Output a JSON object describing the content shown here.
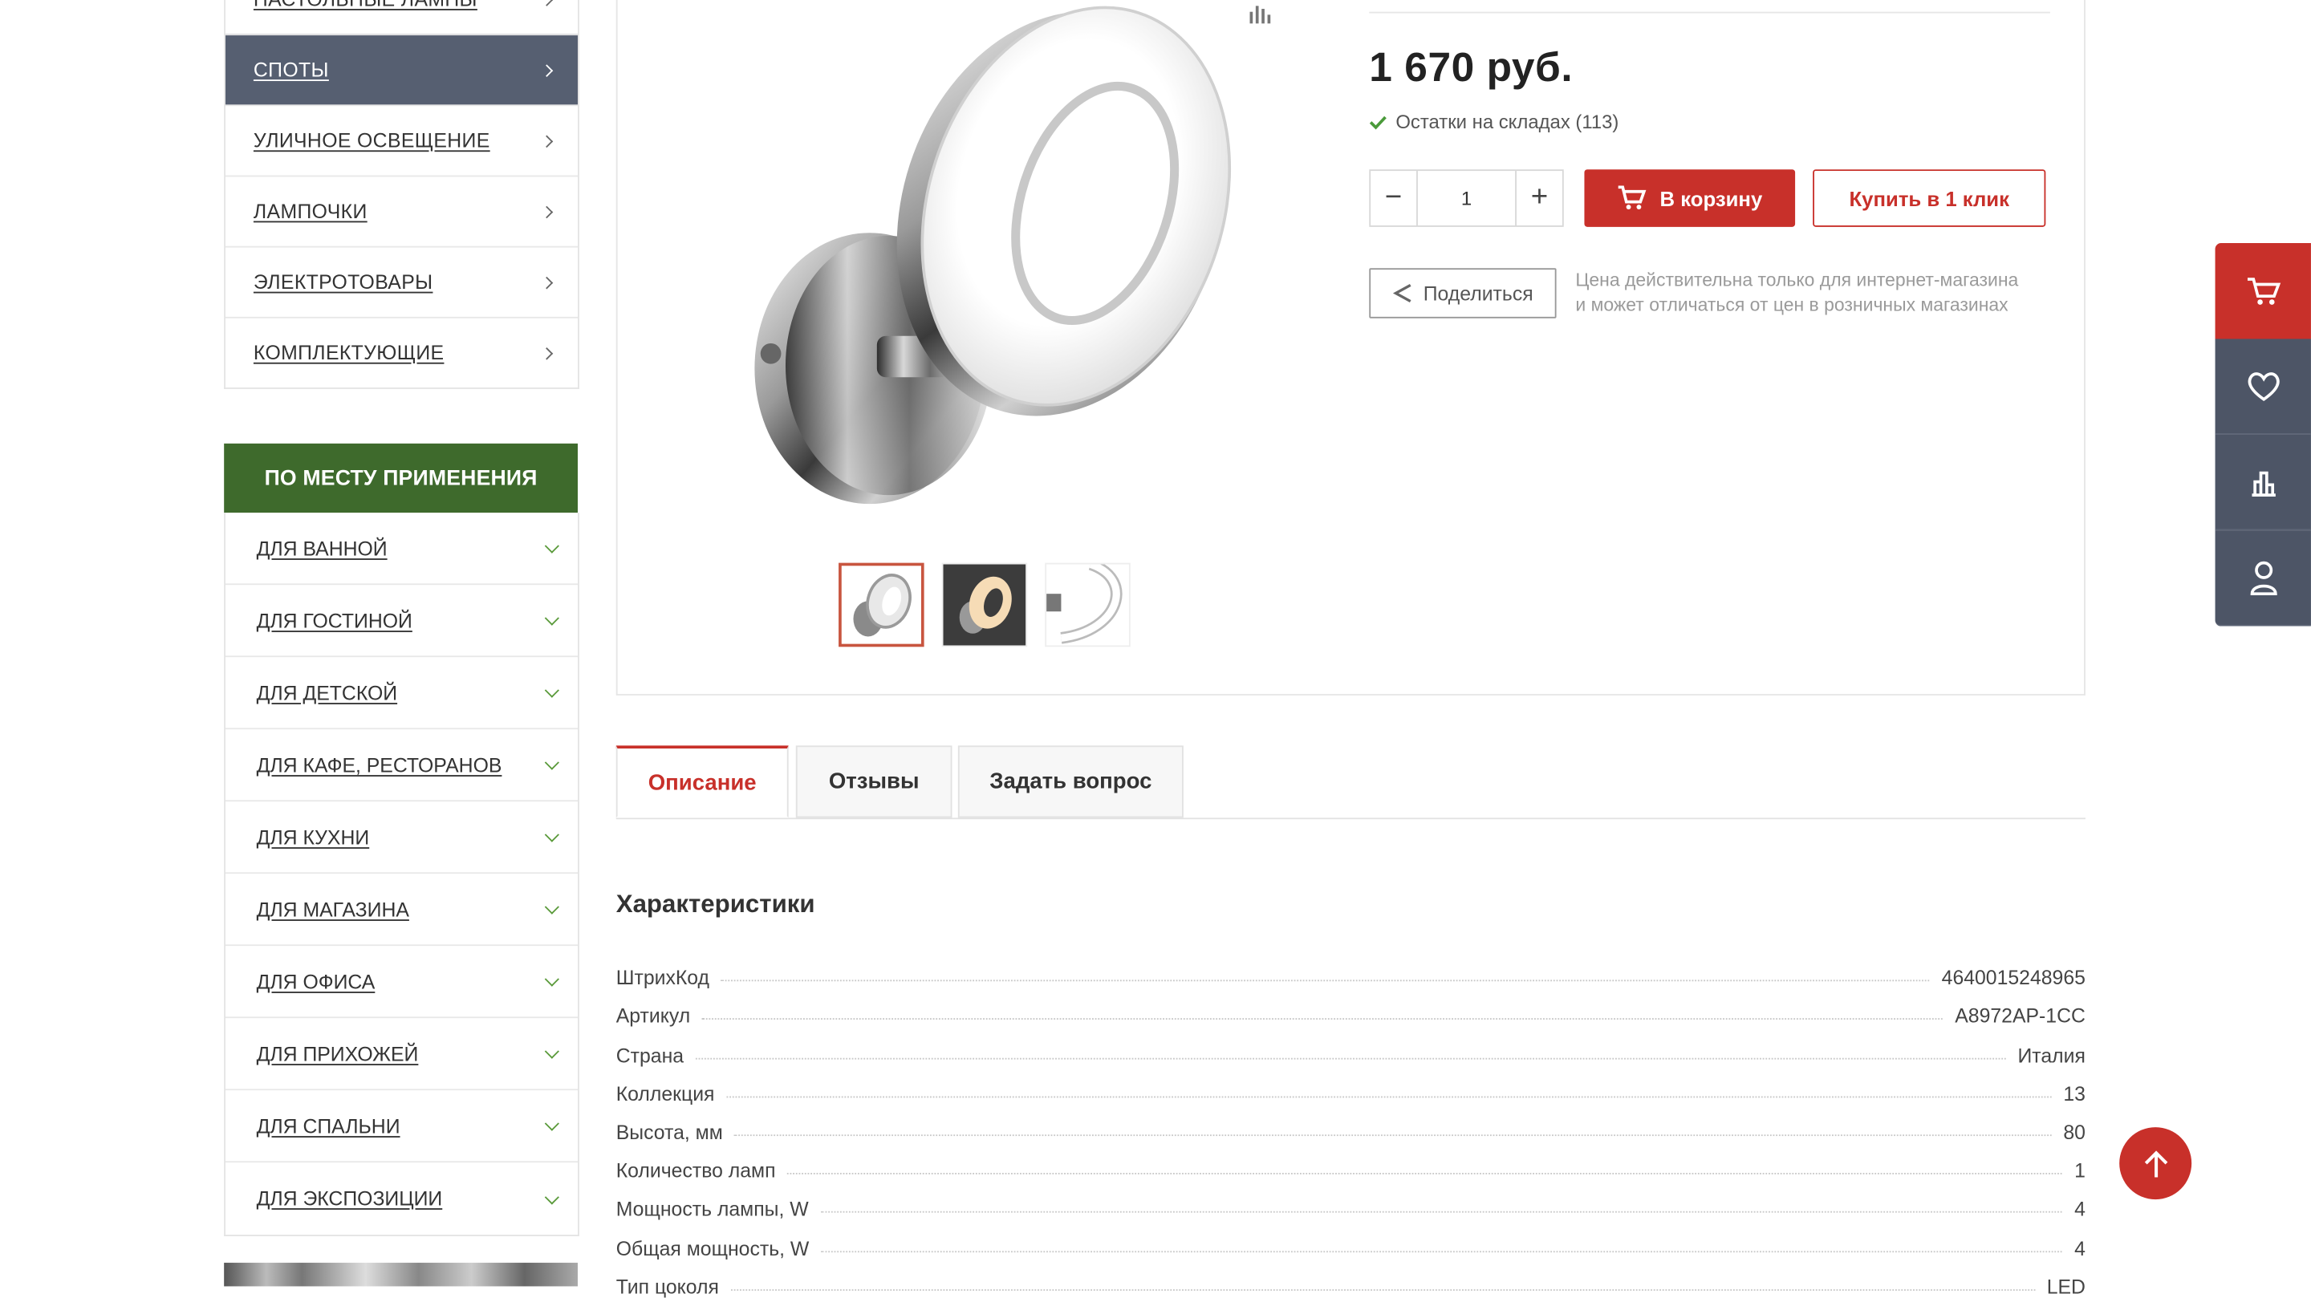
{
  "sidebar": {
    "categories": [
      {
        "label": "НАСТОЛЬНЫЕ ЛАМПЫ"
      },
      {
        "label": "СПОТЫ",
        "active": true
      },
      {
        "label": "УЛИЧНОЕ ОСВЕЩЕНИЕ"
      },
      {
        "label": "ЛАМПОЧКИ"
      },
      {
        "label": "ЭЛЕКТРОТОВАРЫ"
      },
      {
        "label": "КОМПЛЕКТУЮЩИЕ"
      }
    ],
    "place_header": "ПО МЕСТУ ПРИМЕНЕНИЯ",
    "places": [
      {
        "label": "ДЛЯ ВАННОЙ"
      },
      {
        "label": "ДЛЯ ГОСТИНОЙ"
      },
      {
        "label": "ДЛЯ ДЕТСКОЙ"
      },
      {
        "label": "ДЛЯ КАФЕ, РЕСТОРАНОВ"
      },
      {
        "label": "ДЛЯ КУХНИ"
      },
      {
        "label": "ДЛЯ МАГАЗИНА"
      },
      {
        "label": "ДЛЯ ОФИСА"
      },
      {
        "label": "ДЛЯ ПРИХОЖЕЙ"
      },
      {
        "label": "ДЛЯ СПАЛЬНИ"
      },
      {
        "label": "ДЛЯ ЭКСПОЗИЦИИ"
      }
    ]
  },
  "product": {
    "price": "1 670 руб.",
    "stock": "Остатки на складах (113)",
    "qty": "1",
    "qty_minus": "−",
    "qty_plus": "+",
    "cart_button": "В корзину",
    "one_click_button": "Купить в 1 клик",
    "share_button": "Поделиться",
    "price_note_line1": "Цена действительна только для интернет-магазина",
    "price_note_line2": "и может отличаться от цен в розничных магазинах"
  },
  "tabs": [
    {
      "label": "Описание",
      "active": true
    },
    {
      "label": "Отзывы"
    },
    {
      "label": "Задать вопрос"
    }
  ],
  "specs": {
    "title": "Характеристики",
    "rows": [
      {
        "key": "ШтрихКод",
        "value": "4640015248965"
      },
      {
        "key": "Артикул",
        "value": "A8972AP-1CC"
      },
      {
        "key": "Страна",
        "value": "Италия"
      },
      {
        "key": "Коллекция",
        "value": "13"
      },
      {
        "key": "Высота, мм",
        "value": "80"
      },
      {
        "key": "Количество ламп",
        "value": "1"
      },
      {
        "key": "Мощность лампы, W",
        "value": "4"
      },
      {
        "key": "Общая мощность, W",
        "value": "4"
      },
      {
        "key": "Тип цоколя",
        "value": "LED"
      }
    ]
  },
  "colors": {
    "accent_red": "#c8302a",
    "active_category": "#565f71",
    "place_header_green": "#3e6a2c",
    "right_panel": "#4d5566"
  },
  "icons": [
    "chevron-right-icon",
    "chevron-down-icon",
    "compare-icon",
    "check-icon",
    "cart-icon",
    "share-icon",
    "heart-icon",
    "chart-icon",
    "user-icon",
    "arrow-up-icon"
  ]
}
